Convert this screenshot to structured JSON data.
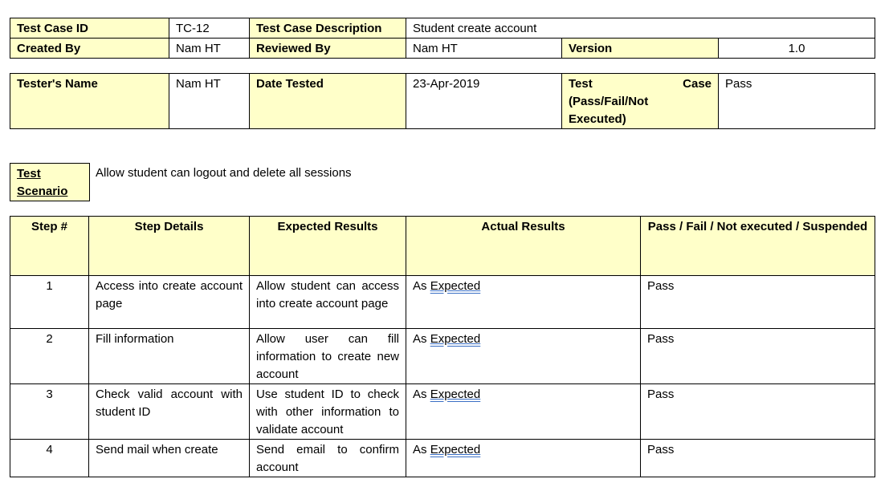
{
  "header": {
    "test_case_id_label": "Test Case ID",
    "test_case_id": "TC-12",
    "description_label": "Test Case Description",
    "description": "Student create account",
    "created_by_label": "Created By",
    "created_by": "Nam HT",
    "reviewed_by_label": "Reviewed By",
    "reviewed_by": "Nam HT",
    "version_label": "Version",
    "version": "1.0"
  },
  "tester": {
    "name_label": "Tester's Name",
    "name": "Nam HT",
    "date_label": "Date Tested",
    "date": "23-Apr-2019",
    "result_label_1": "Test",
    "result_label_2": "Case",
    "result_label_3": "(Pass/Fail/Not",
    "result_label_4": "Executed)",
    "result": "Pass"
  },
  "scenario": {
    "label_1": "Test",
    "label_2": "Scenario",
    "text": "Allow student can logout and delete all sessions"
  },
  "steps_table": {
    "columns": [
      "Step #",
      "Step Details",
      "Expected Results",
      "Actual Results",
      "Pass / Fail / Not executed / Suspended"
    ],
    "rows": [
      {
        "step": "1",
        "details": "Access into create account page",
        "expected": "Allow student can access into create account page",
        "actual_prefix": "As",
        "actual_word": "Expected",
        "status": "Pass"
      },
      {
        "step": "2",
        "details": "Fill information",
        "expected": "Allow user can fill information to create new account",
        "actual_prefix": "As",
        "actual_word": "Expected",
        "status": "Pass"
      },
      {
        "step": "3",
        "details": "Check valid account with student ID",
        "expected": "Use student ID to check with other information to validate account",
        "actual_prefix": "As",
        "actual_word": "Expected",
        "status": "Pass"
      },
      {
        "step": "4",
        "details": "Send mail when create",
        "expected": "Send email to confirm account",
        "actual_prefix": "As",
        "actual_word": "Expected",
        "status": "Pass"
      }
    ]
  }
}
